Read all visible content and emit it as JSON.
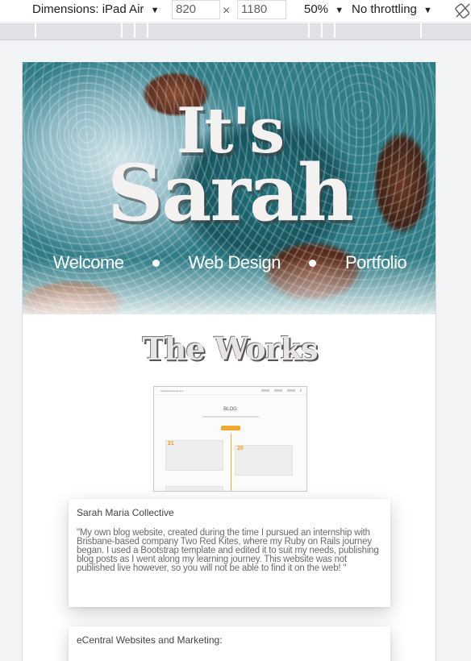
{
  "devtools": {
    "dimensions_label": "Dimensions: iPad Air",
    "width_value": "820",
    "times": "×",
    "height_value": "1180",
    "zoom": "50%",
    "throttling": "No throttling",
    "caret": "▼"
  },
  "hero": {
    "title_line1": "It's",
    "title_line2": "Sarah",
    "nav": [
      "Welcome",
      "Web Design",
      "Portfolio"
    ]
  },
  "works": {
    "heading": "The Works",
    "thumbnail": {
      "brand": "SarahMariaCollective",
      "blog_title": "BLOG",
      "num_a": "21",
      "num_b": "20"
    },
    "items": [
      {
        "title": "Sarah Maria Collective",
        "description": "\"My own blog website, created during the time I pursued an internship with Brisbane-based company Two Red Kites, where my Ruby on Rails journey began. I used a Bootstrap template and edited it to suit my needs, publishing blog posts as I went along my learning journey. This website was not published live however, so you will not be able to find it on the web! \""
      },
      {
        "title": "eCentral Websites and Marketing:",
        "description": ""
      }
    ]
  }
}
